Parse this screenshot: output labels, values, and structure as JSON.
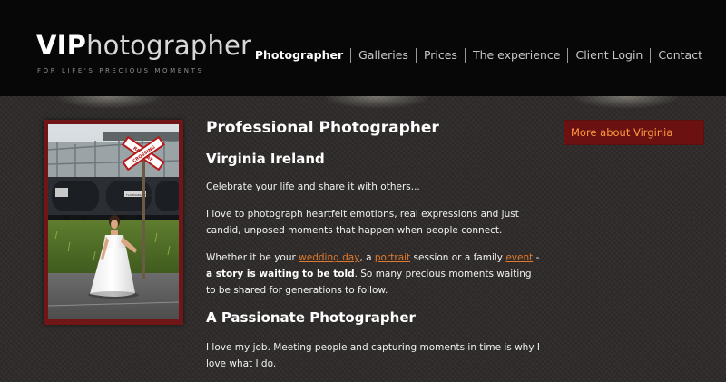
{
  "header": {
    "logo_vip": "VIP",
    "logo_rest": "hotographer",
    "tagline": "FOR LIFE'S PRECIOUS MOMENTS"
  },
  "nav": {
    "items": [
      {
        "label": "Photographer",
        "active": true
      },
      {
        "label": "Galleries"
      },
      {
        "label": "Prices"
      },
      {
        "label": "The experience"
      },
      {
        "label": "Client Login"
      },
      {
        "label": "Contact"
      }
    ]
  },
  "photo": {
    "sign_line1": "RAILWAY",
    "sign_line2": "CROSSING",
    "tank_label": "FLAMMABLE LIQUID"
  },
  "main": {
    "heading": "Professional Photographer",
    "name": "Virginia Ireland",
    "p1": "Celebrate your life and share it with others...",
    "p2": "I love to photograph heartfelt emotions, real expressions and just candid, unposed moments that happen when people connect.",
    "p3": {
      "t1": "Whether it be your ",
      "link1": "wedding day",
      "t2": ", a ",
      "link2": "portrait",
      "t3": " session or a family ",
      "link3": "event",
      "t4": " - ",
      "bold": "a story is waiting to be told",
      "t5": ". So many precious moments waiting to be shared for generations to follow."
    },
    "heading2": "A Passionate Photographer",
    "p4": "I love my job. Meeting people and capturing moments in time is why I love what I do."
  },
  "sidebar": {
    "link": "More about Virginia"
  },
  "colors": {
    "accent_link": "#e07a2e",
    "sidebar_link": "#ff9a3d",
    "frame": "#701617"
  }
}
